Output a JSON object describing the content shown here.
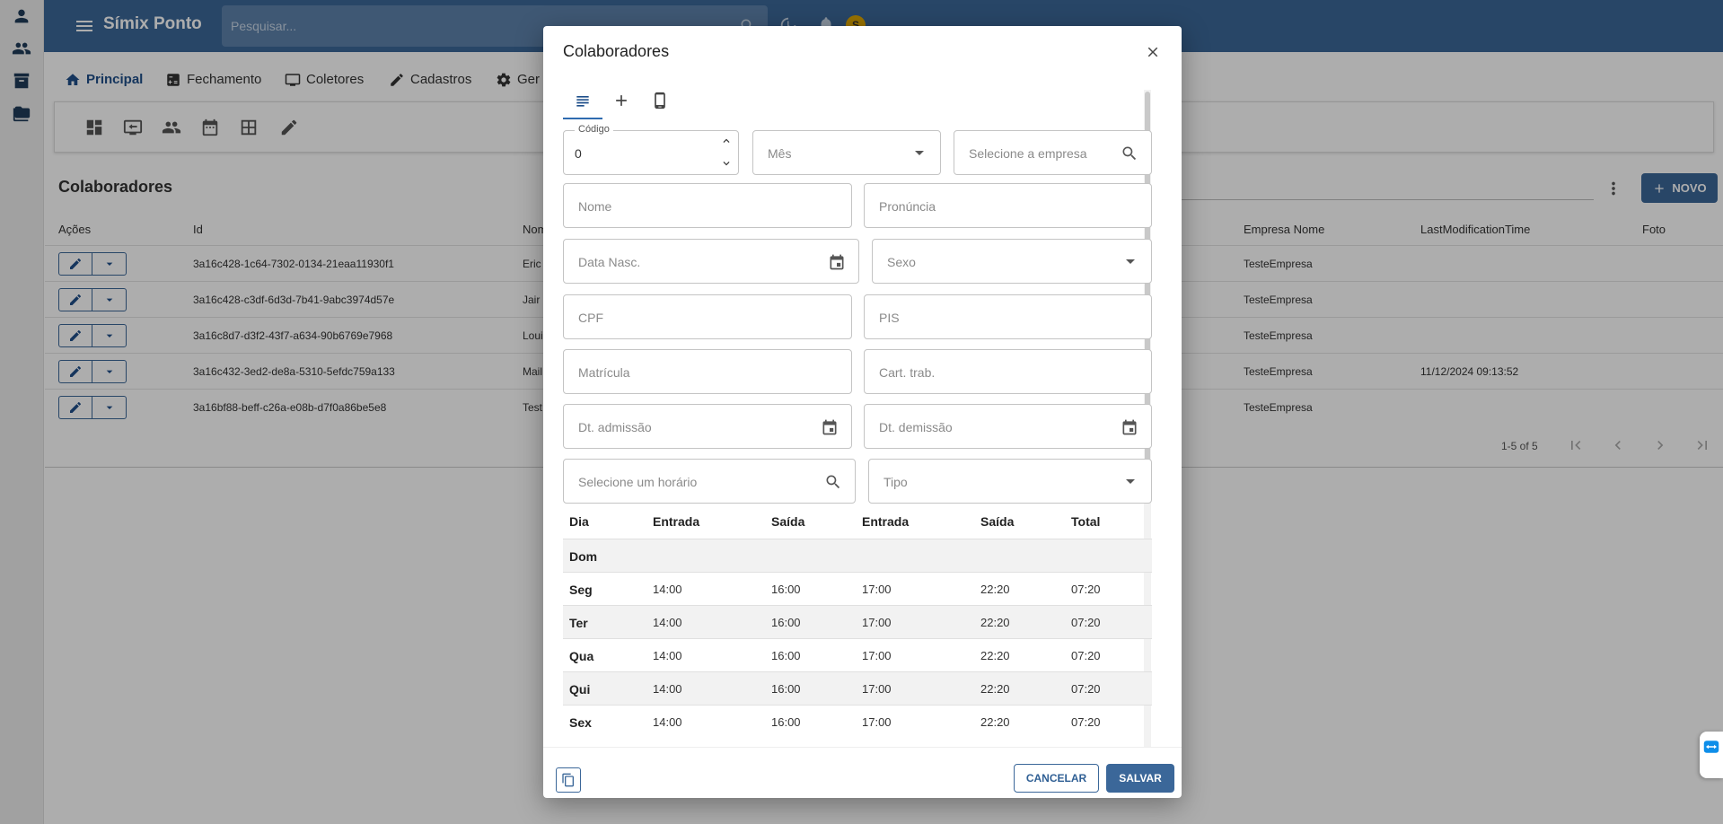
{
  "app": {
    "title": "Símix Ponto",
    "avatar_letter": "S",
    "brand_color": "#3b6799"
  },
  "search": {
    "placeholder": "Pesquisar..."
  },
  "rail": {
    "icons": [
      "person-icon",
      "people-icon",
      "archive-icon",
      "folder-icon"
    ]
  },
  "tabs": [
    {
      "label": "Principal",
      "icon": "home-icon",
      "active": true
    },
    {
      "label": "Fechamento",
      "icon": "calculator-icon",
      "active": false
    },
    {
      "label": "Coletores",
      "icon": "monitor-icon",
      "active": false
    },
    {
      "label": "Cadastros",
      "icon": "pencil-icon",
      "active": false
    },
    {
      "label": "Ger",
      "icon": "gear-icon",
      "active": false
    }
  ],
  "toolbar": {
    "icons": [
      "dashboard-icon",
      "transfer-icon",
      "people-icon",
      "calendar-icon",
      "grid-icon",
      "pencil-icon"
    ]
  },
  "list": {
    "title": "Colaboradores",
    "new_label": "NOVO",
    "columns": [
      "Ações",
      "Id",
      "Nom",
      "Empresa Nome",
      "LastModificationTime",
      "Foto"
    ],
    "rows": [
      {
        "id": "3a16c428-1c64-7302-0134-21eaa11930f1",
        "nome": "Eric",
        "empresa": "TesteEmpresa",
        "modified": ""
      },
      {
        "id": "3a16c428-c3df-6d3d-7b41-9abc3974d57e",
        "nome": "Jair",
        "empresa": "TesteEmpresa",
        "modified": ""
      },
      {
        "id": "3a16c8d7-d3f2-43f7-a634-90b6769e7968",
        "nome": "Loui",
        "empresa": "TesteEmpresa",
        "modified": ""
      },
      {
        "id": "3a16c432-3ed2-de8a-5310-5efdc759a133",
        "nome": "Mail",
        "empresa": "TesteEmpresa",
        "modified": "11/12/2024 09:13:52"
      },
      {
        "id": "3a16bf88-beff-c26a-e08b-d7f0a86be5e8",
        "nome": "Test",
        "empresa": "TesteEmpresa",
        "modified": ""
      }
    ],
    "pager": "1-5 of 5"
  },
  "dialog": {
    "title": "Colaboradores",
    "tabs": [
      "list-icon",
      "add-icon",
      "phone-icon"
    ],
    "fields": {
      "codigo_label": "Código",
      "codigo_value": "0",
      "mes": "Mês",
      "empresa": "Selecione a empresa",
      "nome": "Nome",
      "pronuncia": "Pronúncia",
      "data_nasc": "Data Nasc.",
      "sexo": "Sexo",
      "cpf": "CPF",
      "pis": "PIS",
      "matricula": "Matrícula",
      "cart_trab": "Cart. trab.",
      "dt_admissao": "Dt. admissão",
      "dt_demissao": "Dt. demissão",
      "horario": "Selecione um horário",
      "tipo": "Tipo"
    },
    "schedule": {
      "columns": [
        "Dia",
        "Entrada",
        "Saída",
        "Entrada",
        "Saída",
        "Total"
      ],
      "rows": [
        {
          "day": "Dom",
          "e1": "",
          "s1": "",
          "e2": "",
          "s2": "",
          "total": ""
        },
        {
          "day": "Seg",
          "e1": "14:00",
          "s1": "16:00",
          "e2": "17:00",
          "s2": "22:20",
          "total": "07:20"
        },
        {
          "day": "Ter",
          "e1": "14:00",
          "s1": "16:00",
          "e2": "17:00",
          "s2": "22:20",
          "total": "07:20"
        },
        {
          "day": "Qua",
          "e1": "14:00",
          "s1": "16:00",
          "e2": "17:00",
          "s2": "22:20",
          "total": "07:20"
        },
        {
          "day": "Qui",
          "e1": "14:00",
          "s1": "16:00",
          "e2": "17:00",
          "s2": "22:20",
          "total": "07:20"
        },
        {
          "day": "Sex",
          "e1": "14:00",
          "s1": "16:00",
          "e2": "17:00",
          "s2": "22:20",
          "total": "07:20"
        }
      ]
    },
    "cancel_label": "CANCELAR",
    "save_label": "SALVAR"
  }
}
